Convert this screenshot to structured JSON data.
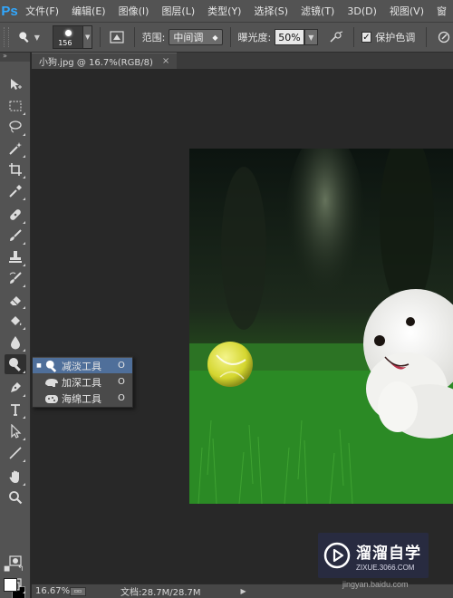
{
  "app": {
    "logo": "Ps"
  },
  "menubar": {
    "items": [
      "文件(F)",
      "编辑(E)",
      "图像(I)",
      "图层(L)",
      "类型(Y)",
      "选择(S)",
      "滤镜(T)",
      "3D(D)",
      "视图(V)",
      "窗"
    ]
  },
  "options": {
    "brush_size": "156",
    "range_label": "范围:",
    "range_value": "中间调",
    "exposure_label": "曝光度:",
    "exposure_value": "50%",
    "protect_tones_label": "保护色调",
    "protect_tones_checked": true
  },
  "toolbar": {
    "header": "»",
    "icons": [
      "move-icon",
      "marquee-icon",
      "lasso-icon",
      "magic-wand-icon",
      "crop-icon",
      "eyedropper-icon",
      "healing-brush-icon",
      "brush-icon",
      "clone-stamp-icon",
      "history-brush-icon",
      "eraser-icon",
      "paint-bucket-icon",
      "blur-icon",
      "dodge-icon",
      "pen-icon",
      "type-icon",
      "path-selection-icon",
      "line-icon",
      "hand-icon",
      "zoom-icon",
      "quick-mask-icon",
      "screen-mode-icon"
    ],
    "foreground_color": "#ffffff",
    "background_color": "#000000"
  },
  "document": {
    "tab_title": "小狗.jpg @ 16.7%(RGB/8)",
    "close_glyph": "×"
  },
  "flyout": {
    "items": [
      {
        "label": "减淡工具",
        "shortcut": "O",
        "icon": "dodge-icon",
        "selected": true
      },
      {
        "label": "加深工具",
        "shortcut": "O",
        "icon": "burn-icon",
        "selected": false
      },
      {
        "label": "海绵工具",
        "shortcut": "O",
        "icon": "sponge-icon",
        "selected": false
      }
    ]
  },
  "status": {
    "zoom": "16.67%",
    "doc_info": "文档:28.7M/28.7M",
    "arrow": "▶"
  },
  "watermark": {
    "title": "溜溜自学",
    "subtitle": "ZIXUE.3066.COM",
    "under": "jingyan.baidu.com"
  },
  "colors": {
    "accent": "#31a8ff",
    "selection": "#4f6f9a",
    "panel": "#535353",
    "canvas_bg": "#282828"
  }
}
